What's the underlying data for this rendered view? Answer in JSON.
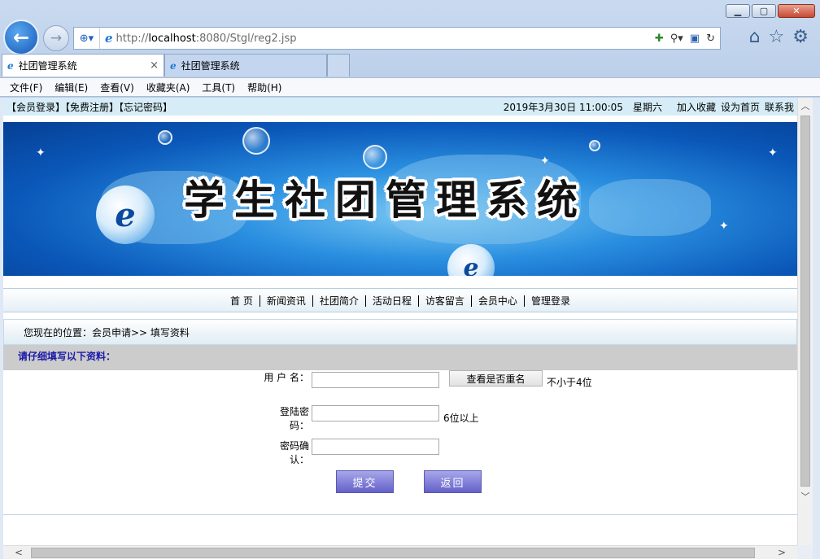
{
  "browser": {
    "address": {
      "prefix": "http://",
      "host": "localhost",
      "rest": ":8080/Stgl/reg2.jsp"
    },
    "tabs": [
      {
        "label": "社团管理系统",
        "active": true,
        "close": "×"
      },
      {
        "label": "社团管理系统",
        "active": false
      }
    ],
    "menu": [
      "文件(F)",
      "编辑(E)",
      "查看(V)",
      "收藏夹(A)",
      "工具(T)",
      "帮助(H)"
    ]
  },
  "page": {
    "topbar": {
      "left": "【会员登录】【免费注册】【忘记密码】",
      "datetime": "2019年3月30日  11:00:05",
      "weekday": "星期六",
      "links": [
        "加入收藏",
        "设为首页",
        "联系我"
      ]
    },
    "banner": {
      "title": "学生社团管理系统"
    },
    "nav": [
      "首 页",
      "新闻资讯",
      "社团简介",
      "活动日程",
      "访客留言",
      "会员中心",
      "管理登录"
    ],
    "breadcrumb": "您现在的位置：会员申请>> 填写资料",
    "form": {
      "heading": "请仔细填写以下资料：",
      "username_label": "用 户 名：",
      "check_button": "查看是否重名",
      "username_hint": "不小于4位",
      "password_label": "登陆密码：",
      "password_hint": "6位以上",
      "confirm_label": "密码确认：",
      "submit": "提交",
      "back": "返回"
    }
  }
}
